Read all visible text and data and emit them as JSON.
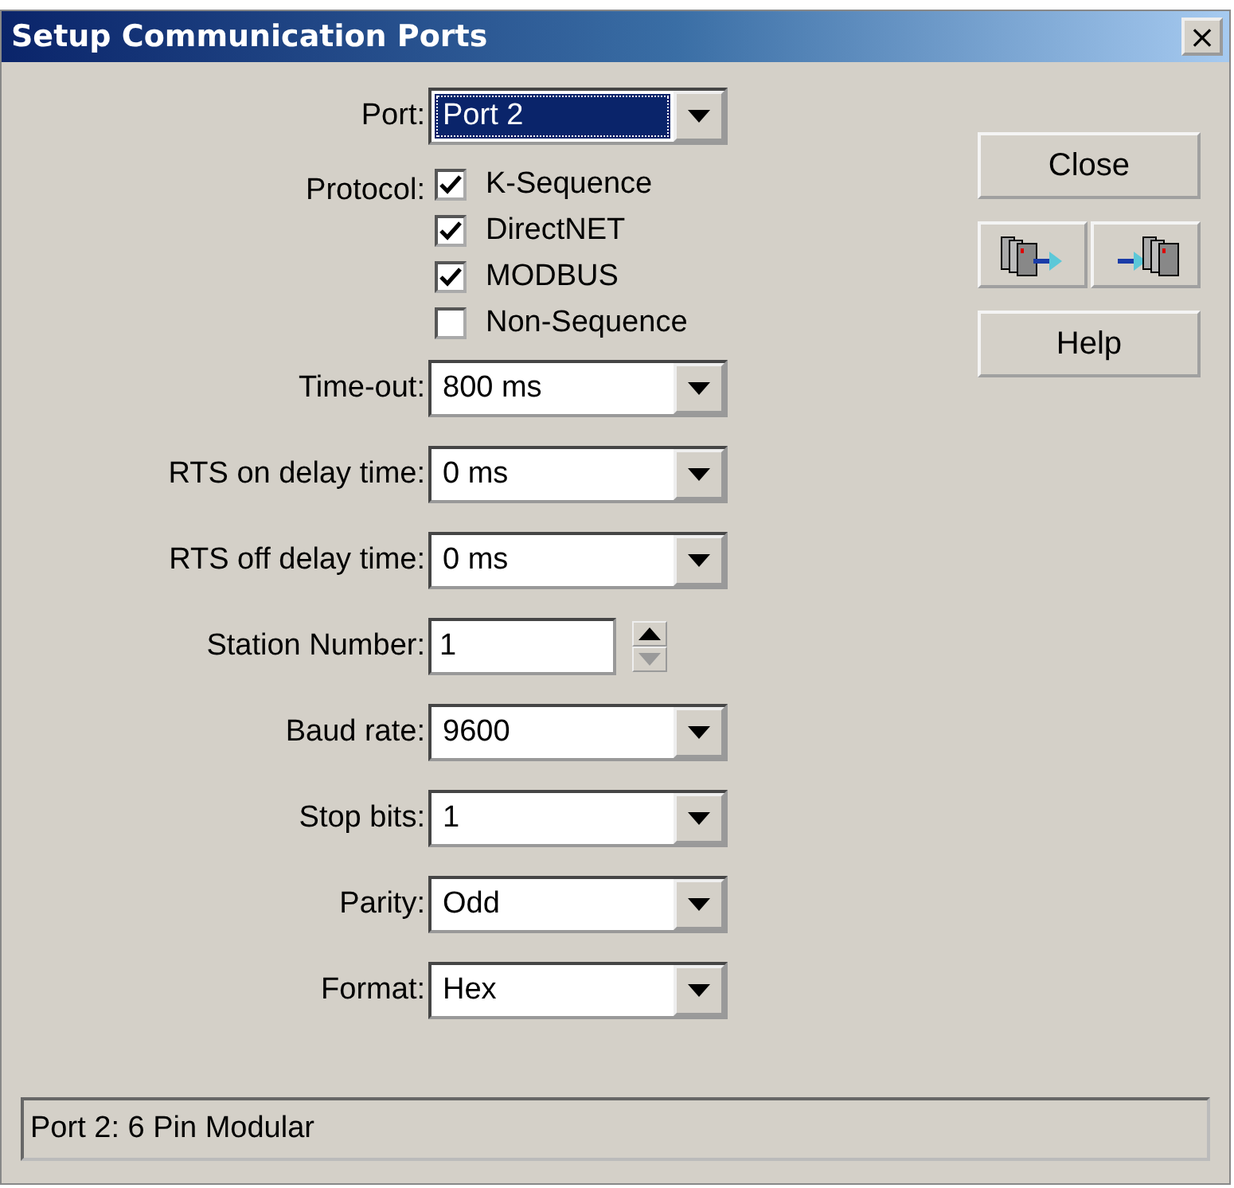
{
  "window": {
    "title": "Setup Communication Ports",
    "close": "×"
  },
  "fields": [
    {
      "kind": "dropdown",
      "label": "Port:",
      "value": "Port 2",
      "focused": true
    },
    {
      "kind": "checks",
      "label": "Protocol:",
      "options": [
        {
          "label": "K-Sequence",
          "checked": true
        },
        {
          "label": "DirectNET",
          "checked": true
        },
        {
          "label": "MODBUS",
          "checked": true
        },
        {
          "label": "Non-Sequence",
          "checked": false
        }
      ]
    },
    {
      "kind": "dropdown",
      "label": "Time-out:",
      "value": "800 ms",
      "focused": false
    },
    {
      "kind": "dropdown",
      "label": "RTS on delay time:",
      "value": "0 ms",
      "focused": false
    },
    {
      "kind": "dropdown",
      "label": "RTS off delay time:",
      "value": "0 ms",
      "focused": false
    },
    {
      "kind": "spinner",
      "label": "Station Number:",
      "value": "1",
      "decrement_disabled": true
    },
    {
      "kind": "dropdown",
      "label": "Baud rate:",
      "value": "9600",
      "focused": false
    },
    {
      "kind": "dropdown",
      "label": "Stop bits:",
      "value": "1",
      "focused": false
    },
    {
      "kind": "dropdown",
      "label": "Parity:",
      "value": "Odd",
      "focused": false
    },
    {
      "kind": "dropdown",
      "label": "Format:",
      "value": "Hex",
      "focused": false
    }
  ],
  "buttons": {
    "close": "Close",
    "help": "Help"
  },
  "status_bar": "Port 2: 6 Pin Modular"
}
